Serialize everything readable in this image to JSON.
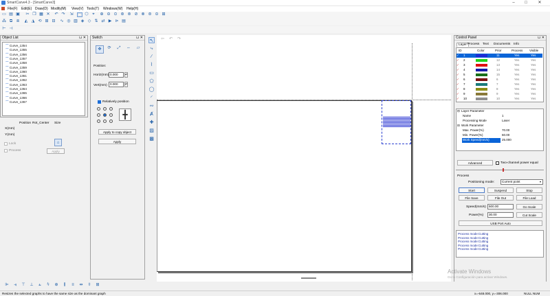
{
  "app": {
    "title": "SmartCarve4.3 - [SmartCarve3]",
    "window_buttons": [
      "–",
      "□",
      "✕"
    ]
  },
  "menu": [
    "File(F)",
    "Edit(E)",
    "Draw(D)",
    "Modify(M)",
    "View(V)",
    "Tools(T)",
    "Windows(W)",
    "Help(H)"
  ],
  "object_list": {
    "header": "Object List",
    "items": [
      "Curve_1354",
      "Curve_1355",
      "Curve_1356",
      "Curve_1357",
      "Curve_1358",
      "Curve_1359",
      "Curve_1360",
      "Curve_1361",
      "Curve_1362",
      "Curve_1363",
      "Curve_1364",
      "Curve_1365",
      "Curve_1366",
      "Curve_1367"
    ]
  },
  "props": {
    "col_position": "Position",
    "col_rot": "Rot_Center",
    "col_size": "Size",
    "x_label": "X(mm)",
    "y_label": "Y(mm)",
    "lock_label": "Lock",
    "process_label": "Process",
    "apply": "Apply"
  },
  "switch_panel": {
    "header": "Switch",
    "position_label": "Position:",
    "horiz_label": "Horiz(mm)",
    "horiz_value": "0.000",
    "vert_label": "Vert(mm)",
    "vert_value": "0.000",
    "relative_label": "Relatively position",
    "apply_copy": "Apply to copy object",
    "apply": "Apply"
  },
  "control_panel": {
    "header": "Control Panel",
    "tabs": [
      "Layer",
      "Process",
      "Text",
      "Documents",
      "Info"
    ],
    "layer_columns": [
      "ID",
      "Color",
      "Prior",
      "Process",
      "Visible"
    ],
    "layers": [
      {
        "id": "1",
        "color": "#1f2ad6",
        "prior": "11",
        "process": "Yes",
        "visible": "Yes",
        "selected": true
      },
      {
        "id": "2",
        "color": "#22d41b",
        "prior": "12",
        "process": "Yes",
        "visible": "Yes",
        "selected": false
      },
      {
        "id": "3",
        "color": "#e01010",
        "prior": "13",
        "process": "Yes",
        "visible": "Yes",
        "selected": false
      },
      {
        "id": "4",
        "color": "#1419a8",
        "prior": "14",
        "process": "Yes",
        "visible": "Yes",
        "selected": false
      },
      {
        "id": "5",
        "color": "#1a6e1a",
        "prior": "15",
        "process": "Yes",
        "visible": "Yes",
        "selected": false
      },
      {
        "id": "6",
        "color": "#7a1010",
        "prior": "6",
        "process": "Yes",
        "visible": "Yes",
        "selected": false
      },
      {
        "id": "7",
        "color": "#1a7a7a",
        "prior": "7",
        "process": "Yes",
        "visible": "Yes",
        "selected": false
      },
      {
        "id": "8",
        "color": "#8c8c12",
        "prior": "8",
        "process": "Yes",
        "visible": "Yes",
        "selected": false
      },
      {
        "id": "9",
        "color": "#8a7a3a",
        "prior": "9",
        "process": "Yes",
        "visible": "Yes",
        "selected": false
      },
      {
        "id": "10",
        "color": "#909090",
        "prior": "10",
        "process": "Yes",
        "visible": "Yes",
        "selected": false
      }
    ],
    "params_title": "Layer Parameter",
    "params": [
      {
        "label": "Name",
        "value": "1"
      },
      {
        "label": "Processing Mode",
        "value": "Laser"
      }
    ],
    "work_title": "Work Parameter",
    "work_params": [
      {
        "label": "Max. Power(%)",
        "value": "70.00"
      },
      {
        "label": "Min. Power(%)",
        "value": "60.00"
      },
      {
        "label": "Work Speed(mm/s)",
        "value": "25.000"
      }
    ],
    "advanced": "Advanced",
    "two_channel": "Two-channel power equal",
    "process_section": "Process",
    "positioning_label": "Positioning mode:",
    "positioning_value": "Current point",
    "start": "Start",
    "suspend": "Suspend",
    "stop": "Stop",
    "file_save": "File Save",
    "file_out": "File Out",
    "file_load": "File Load",
    "speed_label": "Speed(mm/s)",
    "speed_value": "500.00",
    "power_label": "Power(%)",
    "power_value": "30.00",
    "go_scale": "Go Scale",
    "cut_scale": "Cut Scale",
    "usb_port": "USB Port Auto",
    "log": [
      "Process mode:Cutting",
      "Process mode:Cutting",
      "Process mode:Cutting",
      "Process mode:Cutting",
      "Process mode:Cutting"
    ]
  },
  "watermark": {
    "line1": "Activate Windows",
    "line2": "Go to Configuración para activar Windows."
  },
  "status": {
    "message": "Resizes the selected graphs to have the same size as the dominant graph",
    "coords": "x=-648.000, y=-306.000",
    "num": "NULL NUM"
  }
}
